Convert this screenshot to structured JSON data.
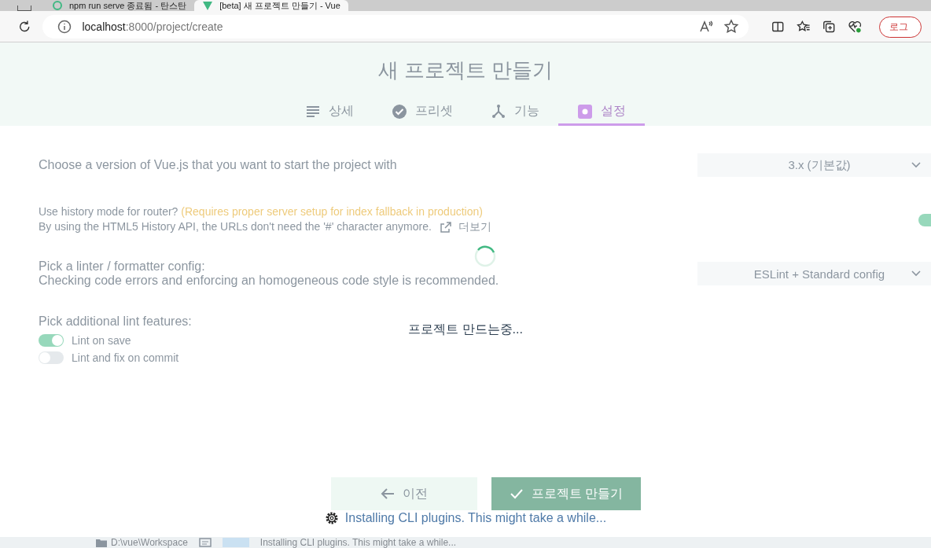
{
  "browser": {
    "tabs": [
      {
        "title": "npm run serve 종료됨 - 탄스탄",
        "selected": false
      },
      {
        "title": "[beta] 새 프로젝트 만들기 - Vue",
        "selected": true
      }
    ],
    "address": {
      "host": "localhost",
      "path": ":8000/project/create"
    },
    "login_button": "로그"
  },
  "page": {
    "title": "새 프로젝트 만들기",
    "steps": [
      {
        "label": "상세",
        "selected": false
      },
      {
        "label": "프리셋",
        "selected": false
      },
      {
        "label": "기능",
        "selected": false
      },
      {
        "label": "설정",
        "selected": true
      }
    ],
    "settings": [
      {
        "kind": "select",
        "label": "Choose a version of Vue.js that you want to start the project with",
        "value": "3.x (기본값)"
      },
      {
        "kind": "switch",
        "label": "Use history mode for router?",
        "warning": "(Requires proper server setup for index fallback in production)",
        "description": "By using the HTML5 History API, the URLs don't need the '#' character anymore.",
        "link": "더보기",
        "on": true
      },
      {
        "kind": "select",
        "label": "Pick a linter / formatter config:",
        "description": "Checking code errors and enforcing an homogeneous code style is recommended.",
        "value": "ESLint + Standard config"
      },
      {
        "kind": "checklist",
        "label": "Pick additional lint features:",
        "options": [
          {
            "label": "Lint on save",
            "on": true
          },
          {
            "label": "Lint and fix on commit",
            "on": false
          }
        ]
      }
    ],
    "buttons": [
      {
        "label": "이전",
        "kind": "back"
      },
      {
        "label": "프로젝트 만들기",
        "kind": "create"
      }
    ]
  },
  "overlay": {
    "message": "프로젝트 만드는중...",
    "status": "Installing CLI plugins. This might take a while..."
  },
  "status_bar": {
    "folder": "D:\\vue\\Workspace",
    "status": "Installing CLI plugins. This might take a while..."
  }
}
